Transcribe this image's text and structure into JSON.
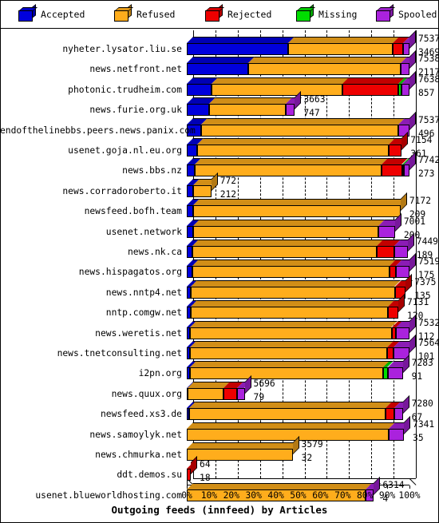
{
  "legend": {
    "items": [
      {
        "label": "Accepted",
        "color": "#0000dd",
        "icon": "cube-icon"
      },
      {
        "label": "Refused",
        "color": "#ffad1c",
        "icon": "cube-icon"
      },
      {
        "label": "Rejected",
        "color": "#ee0000",
        "icon": "cube-icon"
      },
      {
        "label": "Missing",
        "color": "#00dd00",
        "icon": "cube-icon"
      },
      {
        "label": "Spooled",
        "color": "#aa22dd",
        "icon": "cube-icon"
      }
    ]
  },
  "chart_data": {
    "type": "bar",
    "orientation": "horizontal",
    "stacked": true,
    "percent_scale": true,
    "title": "Outgoing feeds (innfeed) by Articles",
    "xlabel": "Outgoing feeds (innfeed) by Articles",
    "ylabel": "",
    "xlim": [
      0,
      100
    ],
    "xticks": [
      "0%",
      "10%",
      "20%",
      "30%",
      "40%",
      "50%",
      "60%",
      "70%",
      "80%",
      "90%",
      "100%"
    ],
    "grid": true,
    "legend_position": "top",
    "series": [
      {
        "name": "Accepted",
        "color": "#0000dd"
      },
      {
        "name": "Refused",
        "color": "#ffad1c"
      },
      {
        "name": "Rejected",
        "color": "#ee0000"
      },
      {
        "name": "Missing",
        "color": "#00dd00"
      },
      {
        "name": "Spooled",
        "color": "#aa22dd"
      }
    ],
    "categories": [
      "nyheter.lysator.liu.se",
      "news.netfront.net",
      "photonic.trudheim.com",
      "news.furie.org.uk",
      "endofthelinebbs.peers.news.panix.com",
      "usenet.goja.nl.eu.org",
      "news.bbs.nz",
      "news.corradoroberto.it",
      "newsfeed.bofh.team",
      "usenet.network",
      "news.nk.ca",
      "news.hispagatos.org",
      "news.nntp4.net",
      "nntp.comgw.net",
      "news.weretis.net",
      "news.tnetconsulting.net",
      "i2pn.org",
      "news.quux.org",
      "newsfeed.xs3.de",
      "news.samoylyk.net",
      "news.chmurka.net",
      "ddt.demos.su",
      "usenet.blueworldhosting.com"
    ],
    "bars": [
      {
        "category": "nyheter.lysator.liu.se",
        "total": 7537,
        "secondary": 3469,
        "bar_pct": 100,
        "segments": [
          {
            "s": "Accepted",
            "pct": 45.5
          },
          {
            "s": "Refused",
            "pct": 47.0
          },
          {
            "s": "Rejected",
            "pct": 4.5
          },
          {
            "s": "Spooled",
            "pct": 3.0
          }
        ]
      },
      {
        "category": "news.netfront.net",
        "total": 7538,
        "secondary": 2117,
        "bar_pct": 100,
        "segments": [
          {
            "s": "Accepted",
            "pct": 27.6
          },
          {
            "s": "Refused",
            "pct": 68.4
          },
          {
            "s": "Spooled",
            "pct": 4.0
          }
        ]
      },
      {
        "category": "photonic.trudheim.com",
        "total": 7638,
        "secondary": 857,
        "bar_pct": 100,
        "segments": [
          {
            "s": "Accepted",
            "pct": 11.0
          },
          {
            "s": "Refused",
            "pct": 59.0
          },
          {
            "s": "Rejected",
            "pct": 25.0
          },
          {
            "s": "Missing",
            "pct": 1.4
          },
          {
            "s": "Spooled",
            "pct": 3.6
          }
        ]
      },
      {
        "category": "news.furie.org.uk",
        "total": 3663,
        "secondary": 747,
        "bar_pct": 48.5,
        "segments": [
          {
            "s": "Accepted",
            "pct": 20.4
          },
          {
            "s": "Refused",
            "pct": 71.0
          },
          {
            "s": "Spooled",
            "pct": 8.6
          }
        ]
      },
      {
        "category": "endofthelinebbs.peers.news.panix.com",
        "total": 7537,
        "secondary": 496,
        "bar_pct": 100,
        "segments": [
          {
            "s": "Accepted",
            "pct": 6.6
          },
          {
            "s": "Refused",
            "pct": 88.4
          },
          {
            "s": "Spooled",
            "pct": 5.0
          }
        ]
      },
      {
        "category": "usenet.goja.nl.eu.org",
        "total": 7154,
        "secondary": 361,
        "bar_pct": 96.5,
        "segments": [
          {
            "s": "Accepted",
            "pct": 5.0
          },
          {
            "s": "Refused",
            "pct": 89.0
          },
          {
            "s": "Rejected",
            "pct": 6.0
          }
        ]
      },
      {
        "category": "news.bbs.nz",
        "total": 7742,
        "secondary": 273,
        "bar_pct": 100,
        "segments": [
          {
            "s": "Accepted",
            "pct": 3.6
          },
          {
            "s": "Refused",
            "pct": 84.0
          },
          {
            "s": "Rejected",
            "pct": 9.0
          },
          {
            "s": "Missing",
            "pct": 0.9
          },
          {
            "s": "Spooled",
            "pct": 2.5
          }
        ]
      },
      {
        "category": "news.corradoroberto.it",
        "total": 772,
        "secondary": 212,
        "bar_pct": 11.0,
        "segments": [
          {
            "s": "Accepted",
            "pct": 27.0
          },
          {
            "s": "Refused",
            "pct": 73.0
          }
        ]
      },
      {
        "category": "newsfeed.bofh.team",
        "total": 7172,
        "secondary": 209,
        "bar_pct": 96.0,
        "segments": [
          {
            "s": "Accepted",
            "pct": 3.0
          },
          {
            "s": "Refused",
            "pct": 97.0
          }
        ]
      },
      {
        "category": "usenet.network",
        "total": 7001,
        "secondary": 200,
        "bar_pct": 93.5,
        "segments": [
          {
            "s": "Accepted",
            "pct": 2.9
          },
          {
            "s": "Refused",
            "pct": 89.1
          },
          {
            "s": "Spooled",
            "pct": 8.0
          }
        ]
      },
      {
        "category": "news.nk.ca",
        "total": 7449,
        "secondary": 189,
        "bar_pct": 99.2,
        "segments": [
          {
            "s": "Accepted",
            "pct": 2.6
          },
          {
            "s": "Refused",
            "pct": 83.4
          },
          {
            "s": "Rejected",
            "pct": 8.0
          },
          {
            "s": "Spooled",
            "pct": 6.0
          }
        ]
      },
      {
        "category": "news.hispagatos.org",
        "total": 7519,
        "secondary": 175,
        "bar_pct": 100,
        "segments": [
          {
            "s": "Accepted",
            "pct": 2.4
          },
          {
            "s": "Refused",
            "pct": 88.6
          },
          {
            "s": "Rejected",
            "pct": 3.0
          },
          {
            "s": "Spooled",
            "pct": 6.0
          }
        ]
      },
      {
        "category": "news.nntp4.net",
        "total": 7375,
        "secondary": 135,
        "bar_pct": 98.3,
        "segments": [
          {
            "s": "Accepted",
            "pct": 1.9
          },
          {
            "s": "Refused",
            "pct": 93.1
          },
          {
            "s": "Rejected",
            "pct": 5.0
          }
        ]
      },
      {
        "category": "nntp.comgw.net",
        "total": 7131,
        "secondary": 120,
        "bar_pct": 95.0,
        "segments": [
          {
            "s": "Accepted",
            "pct": 1.7
          },
          {
            "s": "Refused",
            "pct": 93.3
          },
          {
            "s": "Rejected",
            "pct": 5.0
          }
        ]
      },
      {
        "category": "news.weretis.net",
        "total": 7532,
        "secondary": 112,
        "bar_pct": 100,
        "segments": [
          {
            "s": "Accepted",
            "pct": 1.6
          },
          {
            "s": "Refused",
            "pct": 90.4
          },
          {
            "s": "Rejected",
            "pct": 2.0
          },
          {
            "s": "Spooled",
            "pct": 6.0
          }
        ]
      },
      {
        "category": "news.tnetconsulting.net",
        "total": 7564,
        "secondary": 101,
        "bar_pct": 100,
        "segments": [
          {
            "s": "Accepted",
            "pct": 1.4
          },
          {
            "s": "Refused",
            "pct": 88.6
          },
          {
            "s": "Rejected",
            "pct": 3.0
          },
          {
            "s": "Spooled",
            "pct": 7.0
          }
        ]
      },
      {
        "category": "i2pn.org",
        "total": 7283,
        "secondary": 91,
        "bar_pct": 97.0,
        "segments": [
          {
            "s": "Accepted",
            "pct": 1.3
          },
          {
            "s": "Refused",
            "pct": 89.7
          },
          {
            "s": "Missing",
            "pct": 2.0
          },
          {
            "s": "Spooled",
            "pct": 7.0
          }
        ]
      },
      {
        "category": "news.quux.org",
        "total": 5696,
        "secondary": 79,
        "bar_pct": 26.0,
        "segments": [
          {
            "s": "Accepted",
            "pct": 2.0
          },
          {
            "s": "Refused",
            "pct": 62.0
          },
          {
            "s": "Rejected",
            "pct": 23.0
          },
          {
            "s": "Spooled",
            "pct": 13.0
          }
        ]
      },
      {
        "category": "newsfeed.xs3.de",
        "total": 7280,
        "secondary": 67,
        "bar_pct": 97.0,
        "segments": [
          {
            "s": "Accepted",
            "pct": 1.0
          },
          {
            "s": "Refused",
            "pct": 91.0
          },
          {
            "s": "Rejected",
            "pct": 4.0
          },
          {
            "s": "Spooled",
            "pct": 4.0
          }
        ]
      },
      {
        "category": "news.samoylyk.net",
        "total": 7341,
        "secondary": 35,
        "bar_pct": 97.5,
        "segments": [
          {
            "s": "Refused",
            "pct": 93.0
          },
          {
            "s": "Spooled",
            "pct": 7.0
          }
        ]
      },
      {
        "category": "news.chmurka.net",
        "total": 3579,
        "secondary": 32,
        "bar_pct": 47.5,
        "segments": [
          {
            "s": "Refused",
            "pct": 100
          }
        ]
      },
      {
        "category": "ddt.demos.su",
        "total": 64,
        "secondary": 18,
        "bar_pct": 1.8,
        "segments": [
          {
            "s": "Rejected",
            "pct": 100
          }
        ]
      },
      {
        "category": "usenet.blueworldhosting.com",
        "total": 6314,
        "secondary": 4,
        "bar_pct": 84.0,
        "segments": [
          {
            "s": "Refused",
            "pct": 95.5
          },
          {
            "s": "Spooled",
            "pct": 4.5
          }
        ]
      }
    ]
  }
}
